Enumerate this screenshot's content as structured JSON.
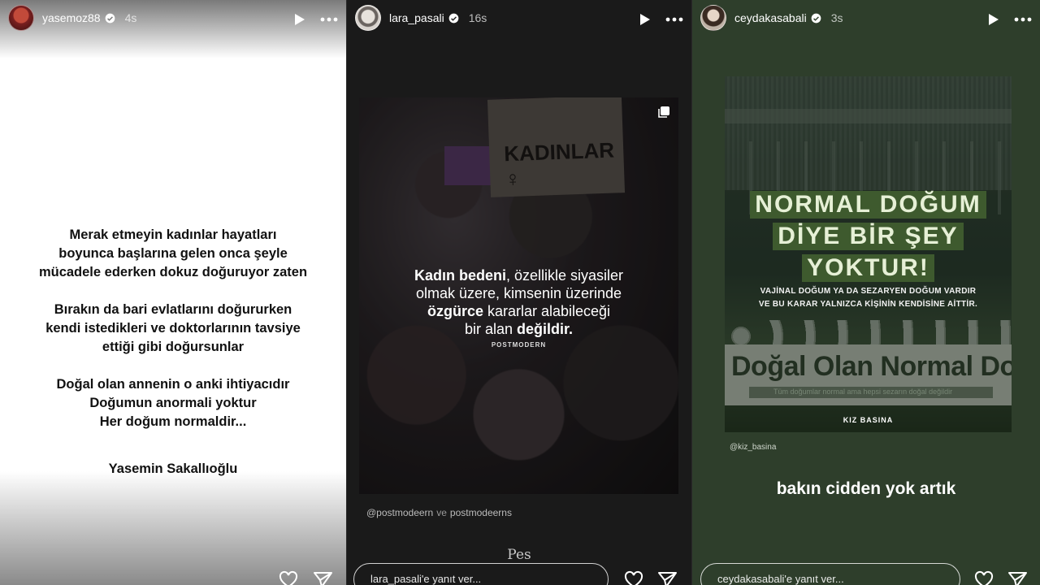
{
  "stories": [
    {
      "username": "yasemoz88",
      "time": "4s",
      "paragraphs": [
        [
          "Merak etmeyin kadınlar hayatları",
          "boyunca başlarına gelen onca şeyle",
          "mücadele ederken dokuz doğuruyor zaten"
        ],
        [
          "Bırakın da bari evlatlarını doğururken",
          "kendi istedikleri ve doktorlarının tavsiye",
          "ettiği gibi doğursunlar"
        ],
        [
          "Doğal olan annenin o anki ihtiyacıdır",
          "Doğumun anormali yoktur",
          "Her doğum normaldir..."
        ]
      ],
      "signature": "Yasemin Sakallıoğlu"
    },
    {
      "username": "lara_pasali",
      "time": "16s",
      "sign_text": "KADINLAR ♀",
      "quote_lines": {
        "l1a": "Kadın bedeni",
        "l1b": ", özellikle siyasiler",
        "l2": "olmak üzere, kimsenin üzerinde",
        "l3a": "özgürce",
        "l3b": " kararlar alabileceği",
        "l4a": "bir alan ",
        "l4b": "değildir."
      },
      "brand": "POSTMODERN",
      "mention_a": "@postmodeern",
      "mention_ve": "ve",
      "mention_b": "postmodeerns",
      "pes": "Pes",
      "reply_placeholder": "lara_pasali'e yanıt ver..."
    },
    {
      "username": "ceydakasabali",
      "time": "3s",
      "headline": [
        "NORMAL DOĞUM",
        "DİYE BİR ŞEY",
        "YOKTUR!"
      ],
      "sub_lines": [
        "VAJİNAL DOĞUM YA DA SEZARYEN DOĞUM VARDIR",
        "VE BU KARAR YALNIZCA KİŞİNİN KENDİSİNE AİTTİR."
      ],
      "banner_text": "Doğal Olan Normal Doğ",
      "banner_small": "Tüm doğumlar normal ama hepsi sezarın doğal değildir",
      "brand": "KIZ BASINA",
      "mention": "@kiz_basina",
      "caption": "bakın cidden yok artık",
      "reply_placeholder": "ceydakasabali'e yanıt ver..."
    }
  ],
  "icons": {
    "play": "play-icon",
    "more": "more-icon",
    "like": "heart-icon",
    "share": "send-icon",
    "verified": "verified-badge-icon"
  },
  "colors": {
    "headline_bg": "#3e5a2e",
    "headline_text": "#e6f0d6",
    "verified": "#ffffff"
  }
}
